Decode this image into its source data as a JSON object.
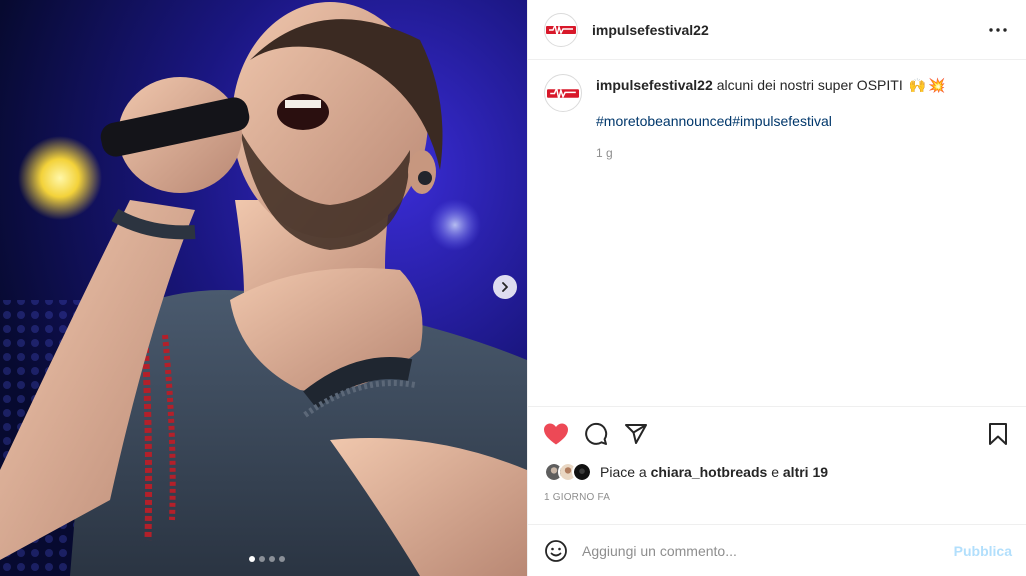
{
  "post": {
    "username": "impulsefestival22",
    "caption": {
      "username": "impulsefestival22",
      "text": "alcuni dei nostri super OSPITI",
      "emojis": [
        "🙌",
        "💥"
      ],
      "hashtags": [
        "#moretobeannounced",
        "#impulsefestival"
      ],
      "time_ago": "1 g"
    },
    "likes": {
      "prefix": "Piace a ",
      "user": "chiara_hotbreads",
      "middle": " e ",
      "others": "altri 19"
    },
    "date": "1 GIORNO FA",
    "comment": {
      "placeholder": "Aggiungi un commento...",
      "publish_label": "Pubblica"
    },
    "carousel": {
      "slide_count": 4,
      "active_index": 0
    }
  },
  "icons": {
    "header_more": "more-horizontal-icon",
    "like": "heart-filled-icon",
    "comment": "comment-icon",
    "share": "share-icon",
    "save": "bookmark-icon",
    "emoji": "emoji-icon",
    "next": "chevron-right-icon"
  },
  "colors": {
    "like_red": "#ed4956",
    "hashtag_blue": "#00376b",
    "muted_text": "#8e8e8e",
    "publish_disabled": "#b2dffc",
    "logo_red": "#d8182a"
  }
}
